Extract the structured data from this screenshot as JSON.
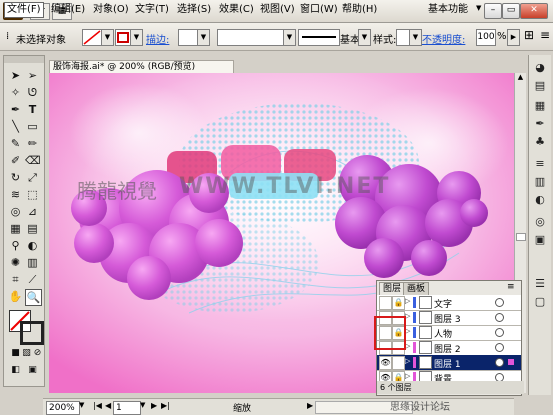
{
  "menubar": {
    "logo": "Ai",
    "items": [
      "文件(F)",
      "编辑(E)",
      "对象(O)",
      "文字(T)",
      "选择(S)",
      "效果(C)",
      "视图(V)",
      "窗口(W)",
      "帮助(H)"
    ],
    "workspace": "基本功能"
  },
  "control": {
    "status": "未选择对象",
    "stroke_label": "描边:",
    "stroke_style": "基本",
    "style_label": "样式:",
    "opacity_label": "不透明度:",
    "opacity_value": "100",
    "opacity_unit": "%"
  },
  "document": {
    "tab": "服饰海报.ai* @ 200% (RGB/预览)"
  },
  "canvas": {
    "watermark_cn": "腾龍視覺",
    "watermark_en": "WWW.TLVI.NET"
  },
  "status": {
    "zoom": "200%",
    "page": "1",
    "mode": "缩放"
  },
  "layers": {
    "tabs": [
      "图层",
      "画板"
    ],
    "rows": [
      {
        "name": "文字",
        "color": "#3a5fdf",
        "selected": false
      },
      {
        "name": "图层 3",
        "color": "#3a5fdf",
        "selected": false
      },
      {
        "name": "人物",
        "color": "#3a5fdf",
        "selected": false
      },
      {
        "name": "图层 2",
        "color": "#e255d8",
        "selected": false
      },
      {
        "name": "图层 1",
        "color": "#e255d8",
        "selected": true
      },
      {
        "name": "背景",
        "color": "#e255d8",
        "selected": false
      }
    ],
    "footer": "6 个图层"
  },
  "watermark": "思缘设计论坛"
}
